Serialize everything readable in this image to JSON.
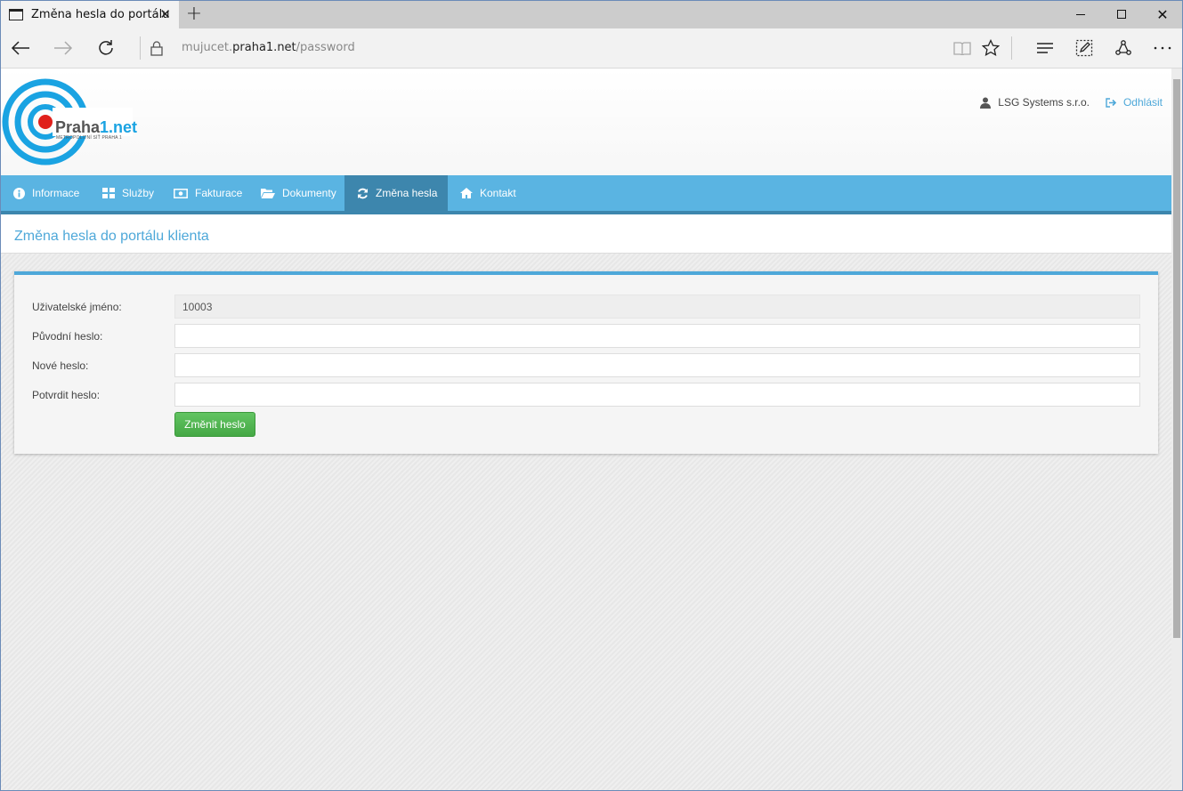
{
  "browser": {
    "tab_title": "Změna hesla do portálu",
    "address_prefix": "mujucet.",
    "address_host": "praha1.net",
    "address_path": "/password",
    "newtab_label": "+",
    "close_tab_label": "✕",
    "window_close_label": "✕"
  },
  "brand": {
    "name_part1": "Praha",
    "name_part2": "1",
    "name_part3": ".net",
    "tagline": "METROPOLITNÍ SÍŤ PRAHA 1"
  },
  "header": {
    "user_name": "LSG Systems s.r.o.",
    "logout_label": "Odhlásit"
  },
  "menu": {
    "items": [
      {
        "label": "Informace",
        "icon": "info-icon"
      },
      {
        "label": "Služby",
        "icon": "grid-icon"
      },
      {
        "label": "Fakturace",
        "icon": "money-icon"
      },
      {
        "label": "Dokumenty",
        "icon": "folder-icon"
      },
      {
        "label": "Změna hesla",
        "icon": "refresh-icon",
        "active": true
      },
      {
        "label": "Kontakt",
        "icon": "home-icon"
      }
    ]
  },
  "page": {
    "title": "Změna hesla do portálu klienta"
  },
  "form": {
    "username_label": "Uživatelské jméno:",
    "username_value": "10003",
    "old_password_label": "Původní heslo:",
    "new_password_label": "Nové heslo:",
    "confirm_password_label": "Potvrdit heslo:",
    "submit_label": "Změnit heslo"
  },
  "colors": {
    "accent": "#5ab4e2",
    "accent_dark": "#3d86ad",
    "link": "#4ea8d9",
    "button": "#4cae4c"
  }
}
